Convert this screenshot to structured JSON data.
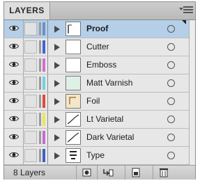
{
  "panel": {
    "tab_label": "LAYERS",
    "tab_close": "x"
  },
  "layers": [
    {
      "name": "Proof",
      "color": "#6b8fd0",
      "selected": true,
      "thumb": "proof-thumbnail"
    },
    {
      "name": "Cutter",
      "color": "#3e64d8",
      "selected": false,
      "thumb": "blank-thumbnail"
    },
    {
      "name": "Emboss",
      "color": "#d86bcf",
      "selected": false,
      "thumb": "blank-thumbnail"
    },
    {
      "name": "Matt Varnish",
      "color": "#6fd2e0",
      "selected": false,
      "thumb": "varnish-thumbnail"
    },
    {
      "name": "Foil",
      "color": "#e04a3a",
      "selected": false,
      "thumb": "foil-thumbnail"
    },
    {
      "name": "Lt Varietal",
      "color": "#e7e85a",
      "selected": false,
      "thumb": "curve-thumbnail"
    },
    {
      "name": "Dark Varietal",
      "color": "#c76ad6",
      "selected": false,
      "thumb": "curve-thumbnail"
    },
    {
      "name": "Type",
      "color": "#3f5ec7",
      "selected": false,
      "thumb": "type-thumbnail"
    }
  ],
  "footer": {
    "layer_count": "8 Layers",
    "buttons": [
      "make-clipping-mask",
      "create-sublayer",
      "create-layer",
      "delete-layer"
    ]
  }
}
